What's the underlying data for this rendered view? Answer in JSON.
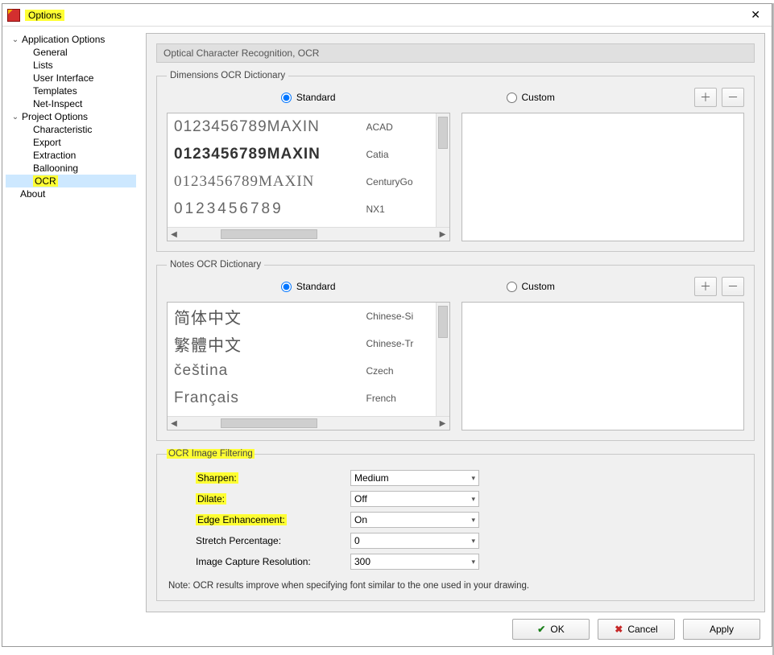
{
  "window": {
    "title": "Options"
  },
  "sidebar": {
    "appOptions": {
      "label": "Application Options",
      "items": [
        "General",
        "Lists",
        "User Interface",
        "Templates",
        "Net-Inspect"
      ]
    },
    "projOptions": {
      "label": "Project Options",
      "items": [
        "Characteristic",
        "Export",
        "Extraction",
        "Ballooning",
        "OCR"
      ],
      "selected": "OCR"
    },
    "about": "About"
  },
  "section": {
    "title": "Optical Character Recognition, OCR"
  },
  "dimDict": {
    "legend": "Dimensions OCR Dictionary",
    "standard": "Standard",
    "custom": "Custom",
    "mode": "Standard",
    "rows": [
      {
        "sample": "0123456789MAXIN",
        "name": "ACAD",
        "style": "thin"
      },
      {
        "sample": "0123456789MAXIN",
        "name": "Catia",
        "style": "bold"
      },
      {
        "sample": "0123456789MAXIN",
        "name": "CenturyGo",
        "style": "serif"
      },
      {
        "sample": "0123456789",
        "name": "NX1",
        "style": "thin"
      }
    ]
  },
  "notesDict": {
    "legend": "Notes OCR Dictionary",
    "standard": "Standard",
    "custom": "Custom",
    "mode": "Standard",
    "rows": [
      {
        "sample": "简体中文",
        "name": "Chinese-Si",
        "style": "cjk"
      },
      {
        "sample": "繁體中文",
        "name": "Chinese-Tr",
        "style": "cjk"
      },
      {
        "sample": "čeština",
        "name": "Czech",
        "style": ""
      },
      {
        "sample": "Français",
        "name": "French",
        "style": ""
      }
    ]
  },
  "filter": {
    "legend": "OCR Image Filtering",
    "sharpenLabel": "Sharpen:",
    "sharpenValue": "Medium",
    "dilateLabel": "Dilate:",
    "dilateValue": "Off",
    "edgeLabel": "Edge Enhancement:",
    "edgeValue": "On",
    "stretchLabel": "Stretch Percentage:",
    "stretchValue": "0",
    "resLabel": "Image Capture Resolution:",
    "resValue": "300"
  },
  "note": "Note: OCR results improve when specifying font similar to the one used in your drawing.",
  "buttons": {
    "ok": "OK",
    "cancel": "Cancel",
    "apply": "Apply"
  }
}
